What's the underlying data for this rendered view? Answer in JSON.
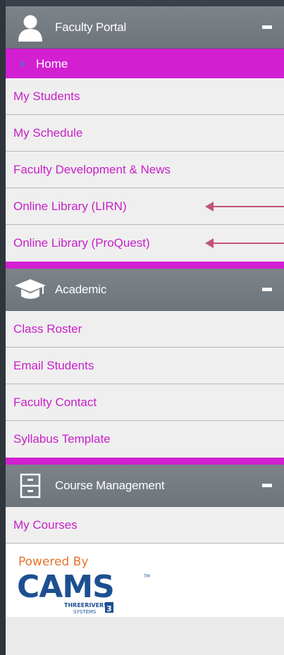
{
  "sections": [
    {
      "title": "Faculty Portal",
      "icon": "user-icon",
      "items": [
        "My Students",
        "My Schedule",
        "Faculty Development & News",
        "Online Library (LIRN)",
        "Online Library (ProQuest)"
      ]
    },
    {
      "title": "Academic",
      "icon": "graduation-cap-icon",
      "items": [
        "Class Roster",
        "Email Students",
        "Faculty Contact",
        "Syllabus Template"
      ]
    },
    {
      "title": "Course Management",
      "icon": "filing-cabinet-icon",
      "items": [
        "My Courses"
      ]
    }
  ],
  "home_label": "Home",
  "footer": {
    "powered_by": "Powered By",
    "brand": "CAMS",
    "brand_sub_1": "THREERIVERS",
    "brand_sub_2": "SYSTEMS"
  },
  "colors": {
    "accent": "#d21fd2",
    "link": "#c81fc8",
    "header": "#747b81",
    "annotation": "#c2537a",
    "brand_orange": "#e6732a",
    "brand_blue": "#1d4f91"
  }
}
